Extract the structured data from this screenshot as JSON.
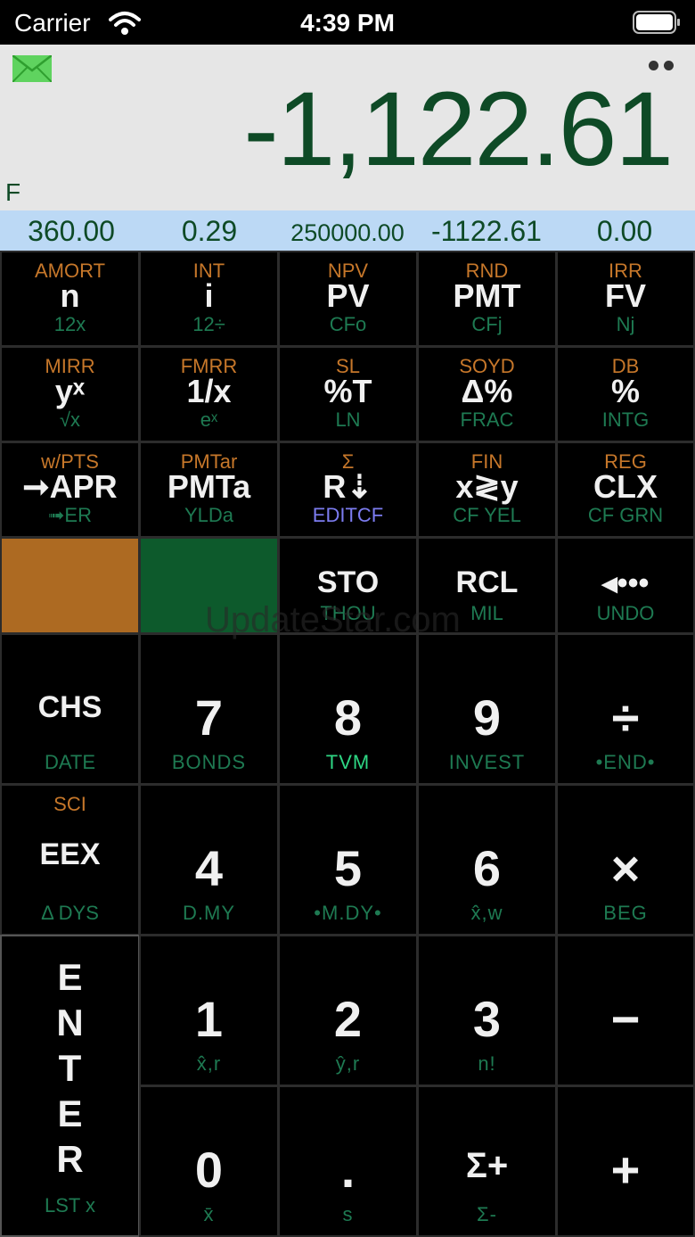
{
  "status": {
    "carrier": "Carrier",
    "time": "4:39 PM"
  },
  "display": {
    "value": "-1,122.61",
    "indicator": "F"
  },
  "registers": [
    "360.00",
    "0.29",
    "250000.00",
    "-1122.61",
    "0.00"
  ],
  "rows": {
    "r1": [
      {
        "top": "AMORT",
        "main": "n",
        "bot": "12x"
      },
      {
        "top": "INT",
        "main": "i",
        "bot": "12÷"
      },
      {
        "top": "NPV",
        "main": "PV",
        "bot": "CFo"
      },
      {
        "top": "RND",
        "main": "PMT",
        "bot": "CFj"
      },
      {
        "top": "IRR",
        "main": "FV",
        "bot": "Nj"
      }
    ],
    "r2": [
      {
        "top": "MIRR",
        "main": "yˣ",
        "bot": "√x"
      },
      {
        "top": "FMRR",
        "main": "1/x",
        "bot": "eˣ"
      },
      {
        "top": "SL",
        "main": "%T",
        "bot": "LN"
      },
      {
        "top": "SOYD",
        "main": "Δ%",
        "bot": "FRAC"
      },
      {
        "top": "DB",
        "main": "%",
        "bot": "INTG"
      }
    ],
    "r3": [
      {
        "top": "w/PTS",
        "main": "➞APR",
        "bot": "➟ER"
      },
      {
        "top": "PMTar",
        "main": "PMTa",
        "bot": "YLDa"
      },
      {
        "top": "Σ",
        "main": "R⇣",
        "bot": "EDITCF"
      },
      {
        "top": "FIN",
        "main": "x≷y",
        "bot": "CF YEL"
      },
      {
        "top": "REG",
        "main": "CLX",
        "bot": "CF GRN"
      }
    ],
    "r4": [
      {
        "main": "STO",
        "bot": "THOU"
      },
      {
        "main": "RCL",
        "bot": "MIL"
      },
      {
        "main": "◂•••",
        "bot": "UNDO"
      }
    ],
    "r5": [
      {
        "main": "CHS",
        "bot": "DATE"
      },
      {
        "main": "7",
        "bot": "BONDS"
      },
      {
        "main": "8",
        "bot": "TVM"
      },
      {
        "main": "9",
        "bot": "INVEST"
      },
      {
        "main": "÷",
        "bot": "•END•"
      }
    ],
    "r6": [
      {
        "top": "SCI",
        "main": "EEX",
        "bot": "Δ DYS"
      },
      {
        "main": "4",
        "bot": "D.MY"
      },
      {
        "main": "5",
        "bot": "•M.DY•"
      },
      {
        "main": "6",
        "bot": "x̂,w"
      },
      {
        "main": "×",
        "bot": "BEG"
      }
    ],
    "r7": [
      {
        "main": "1",
        "bot": "x̂,r"
      },
      {
        "main": "2",
        "bot": "ŷ,r"
      },
      {
        "main": "3",
        "bot": "n!"
      },
      {
        "main": "−",
        "bot": ""
      }
    ],
    "r8": [
      {
        "main": "0",
        "bot": "x̄"
      },
      {
        "main": ".",
        "bot": "s"
      },
      {
        "main": "Σ+",
        "bot": "Σ-"
      },
      {
        "main": "+",
        "bot": ""
      }
    ],
    "enter": {
      "letters": "E N T E R",
      "bot": "LST x"
    }
  },
  "watermark": "UpdateStar.com",
  "colors": {
    "display_text": "#0e4a26",
    "orange_key": "#ad6a22",
    "green_key": "#0d5a2c",
    "register_bar": "#bcd9f5"
  }
}
